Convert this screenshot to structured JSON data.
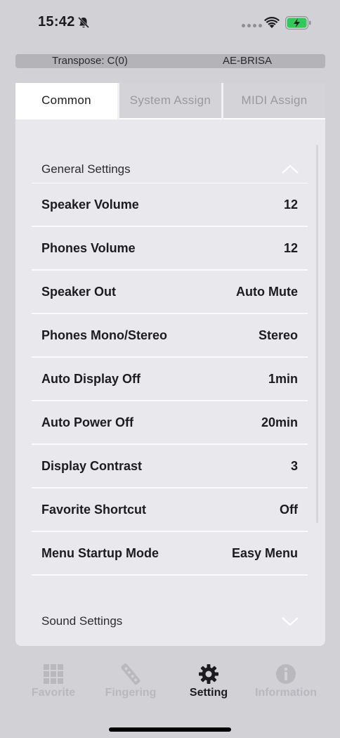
{
  "status_bar": {
    "time": "15:42"
  },
  "transpose_bar": {
    "transpose": "Transpose: C(0)",
    "device": "AE-BRISA"
  },
  "tabs": [
    {
      "label": "Common",
      "active": true
    },
    {
      "label": "System Assign",
      "active": false
    },
    {
      "label": "MIDI Assign",
      "active": false
    }
  ],
  "sections": {
    "general": {
      "label": "General Settings",
      "expanded": true
    },
    "sound": {
      "label": "Sound Settings",
      "expanded": false
    }
  },
  "settings": [
    {
      "name": "Speaker Volume",
      "value": "12"
    },
    {
      "name": "Phones Volume",
      "value": "12"
    },
    {
      "name": "Speaker Out",
      "value": "Auto Mute"
    },
    {
      "name": "Phones Mono/Stereo",
      "value": "Stereo"
    },
    {
      "name": "Auto Display Off",
      "value": "1min"
    },
    {
      "name": "Auto Power Off",
      "value": "20min"
    },
    {
      "name": "Display Contrast",
      "value": "3"
    },
    {
      "name": "Favorite Shortcut",
      "value": "Off"
    },
    {
      "name": "Menu Startup Mode",
      "value": "Easy Menu"
    }
  ],
  "bottom_nav": [
    {
      "label": "Favorite",
      "icon": "grid-icon",
      "active": false
    },
    {
      "label": "Fingering",
      "icon": "fingering-icon",
      "active": false
    },
    {
      "label": "Setting",
      "icon": "gear-icon",
      "active": true
    },
    {
      "label": "Information",
      "icon": "info-icon",
      "active": false
    }
  ],
  "colors": {
    "accent": "#1c1c1e",
    "inactive": "#b9b8bd",
    "background": "#d2d1d6",
    "panel": "#e9e8ed"
  }
}
